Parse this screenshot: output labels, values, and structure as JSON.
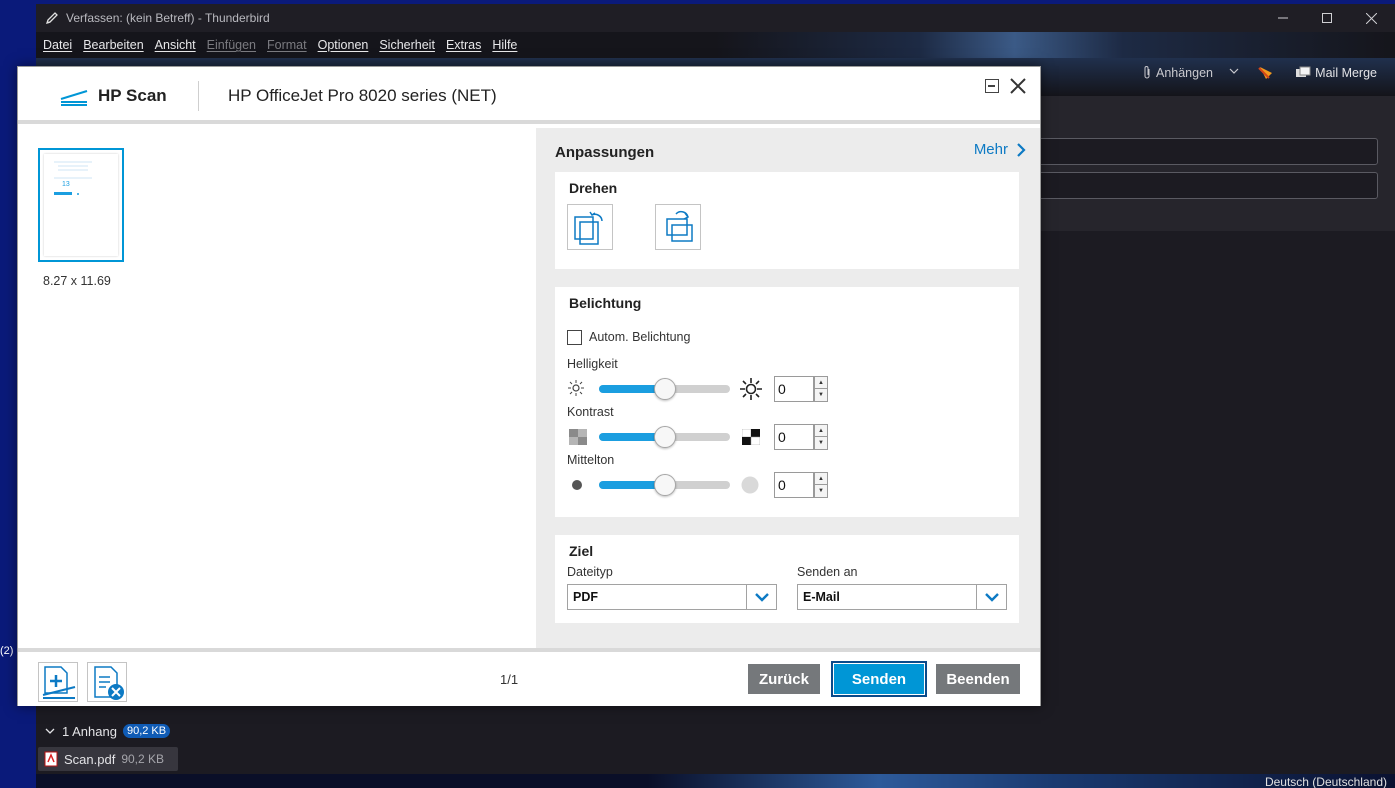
{
  "desktop": {
    "label": "(2)"
  },
  "thunderbird": {
    "title": "Verfassen: (kein Betreff) - Thunderbird",
    "menu": [
      {
        "label": "Datei",
        "enabled": true
      },
      {
        "label": "Bearbeiten",
        "enabled": true
      },
      {
        "label": "Ansicht",
        "enabled": true
      },
      {
        "label": "Einfügen",
        "enabled": false
      },
      {
        "label": "Format",
        "enabled": false
      },
      {
        "label": "Optionen",
        "enabled": true
      },
      {
        "label": "Sicherheit",
        "enabled": true
      },
      {
        "label": "Extras",
        "enabled": true
      },
      {
        "label": "Hilfe",
        "enabled": true
      }
    ],
    "toolbar": {
      "attach_label": "Anhängen",
      "mail_merge_label": "Mail Merge"
    },
    "attachments": {
      "summary": "1 Anhang",
      "total_size": "90,2 KB",
      "file_name": "Scan.pdf",
      "file_size": "90,2 KB"
    },
    "status": {
      "language": "Deutsch (Deutschland)"
    }
  },
  "hp_scan": {
    "app_name": "HP Scan",
    "printer_name": "HP OfficeJet Pro 8020 series (NET)",
    "preview": {
      "page_size": "8.27  x  11.69",
      "thumb_number": "13"
    },
    "panel": {
      "title": "Anpassungen",
      "more_label": "Mehr",
      "rotate": {
        "title": "Drehen"
      },
      "exposure": {
        "title": "Belichtung",
        "auto_label": "Autom. Belichtung",
        "auto_checked": false,
        "brightness": {
          "label": "Helligkeit",
          "value": "0",
          "level": 0.5
        },
        "contrast": {
          "label": "Kontrast",
          "value": "0",
          "level": 0.5
        },
        "midtone": {
          "label": "Mittelton",
          "value": "0",
          "level": 0.5
        }
      },
      "target": {
        "title": "Ziel",
        "filetype_label": "Dateityp",
        "filetype_value": "PDF",
        "send_to_label": "Senden an",
        "send_to_value": "E-Mail"
      }
    },
    "footer": {
      "page_count": "1/1",
      "back_label": "Zurück",
      "send_label": "Senden",
      "finish_label": "Beenden"
    },
    "colors": {
      "accent": "#0096d6",
      "gray_button": "#75787b"
    }
  }
}
